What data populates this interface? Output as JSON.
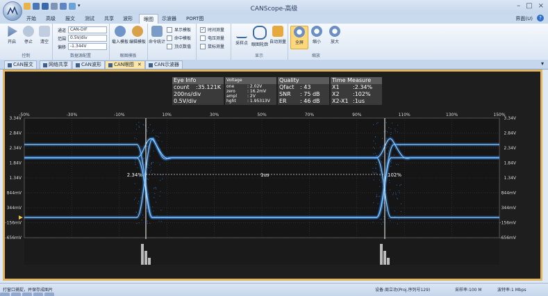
{
  "window": {
    "title": "CANScope-高级",
    "skin_label": "界面(U)",
    "help": "?",
    "controls": [
      "–",
      "□",
      "×"
    ],
    "qat_dropdown": "▾"
  },
  "ribbon_tabs": [
    "开始",
    "高级",
    "报文",
    "测试",
    "共享",
    "波形",
    "眼图",
    "示波器",
    "PORT图"
  ],
  "active_ribbon_tab": "眼图",
  "ribbon": {
    "control": {
      "label": "控制",
      "buttons": [
        "开启",
        "停止",
        "清空"
      ]
    },
    "data_source": {
      "label": "数据源配置",
      "channel_label": "通道",
      "channel": "CAN-DIF",
      "range_label": "范围",
      "range": "0.5V/div",
      "offset_label": "偏移",
      "offset": "-1.344V"
    },
    "mask": {
      "label": "眼图模板",
      "buttons": [
        "载入模板",
        "编辑模板"
      ]
    },
    "stats": {
      "button": "命令统计",
      "checks": [
        {
          "label": "显示模板",
          "checked": false
        },
        {
          "label": "命中模板",
          "checked": false
        },
        {
          "label": "顶点数值",
          "checked": false
        }
      ]
    },
    "measure": {
      "checks": [
        {
          "label": "时间测量",
          "checked": true
        },
        {
          "label": "电压测量",
          "checked": false
        },
        {
          "label": "鼠标测量",
          "checked": false
        }
      ]
    },
    "display": {
      "label": "显示",
      "buttons": [
        "采样点",
        "眼图轮廓",
        "自动测量"
      ]
    },
    "zoom": {
      "label": "缩放",
      "buttons": [
        "全屏",
        "缩小",
        "放大"
      ]
    }
  },
  "doc_tabs": [
    "CAN报文",
    "网络共享",
    "CAN波形",
    "CAN眼图",
    "CAN示波器"
  ],
  "active_doc_tab": "CAN眼图",
  "doc_tab_menu": "▾",
  "eye_info": {
    "title": "Eye Info",
    "rows": [
      [
        "count",
        ":35.121K"
      ],
      [
        "200ns/div",
        ""
      ],
      [
        "0.5V/div",
        ""
      ]
    ]
  },
  "voltage": {
    "title": "Voltage",
    "rows": [
      [
        "one",
        ": 2.02V"
      ],
      [
        "zero",
        ": 16.2mV"
      ],
      [
        "ampl",
        ": 2V"
      ],
      [
        "hght",
        ": 1.95313V"
      ]
    ]
  },
  "quality": {
    "title": "Quality",
    "rows": [
      [
        "Qfact",
        ": 43"
      ],
      [
        "SNR",
        ": 75 dB"
      ],
      [
        "ER",
        ": 46 dB"
      ]
    ]
  },
  "time_measure": {
    "title": "Time Measure",
    "rows": [
      [
        "X1",
        ":2.34%"
      ],
      [
        "X2",
        ":102%"
      ],
      [
        "X2-X1",
        ":1us"
      ]
    ]
  },
  "x_ticks": [
    "-50%",
    "-30%",
    "-10%",
    "10%",
    "30%",
    "50%",
    "70%",
    "90%",
    "110%",
    "130%",
    "150%"
  ],
  "y_ticks": [
    "3.34V",
    "2.84V",
    "2.34V",
    "1.84V",
    "1.34V",
    "844mV",
    "344mV",
    "-156mV",
    "-656mV"
  ],
  "cursor": {
    "x1_label": "2.34%",
    "x2_label": "102%",
    "delta_label": "1us"
  },
  "status": {
    "left": "打窗口捕捉，并保存成图片",
    "device": "设备:周立功(Proj.序列号129)",
    "sample_rate": "采样率:100 M",
    "baud": "波特率:1 Mbps"
  },
  "colors": {
    "accent": "#e2b760",
    "trace": "#2f7fe0",
    "trace_bright": "#8fd0ff",
    "bg_scope": "#1e1e1e"
  }
}
